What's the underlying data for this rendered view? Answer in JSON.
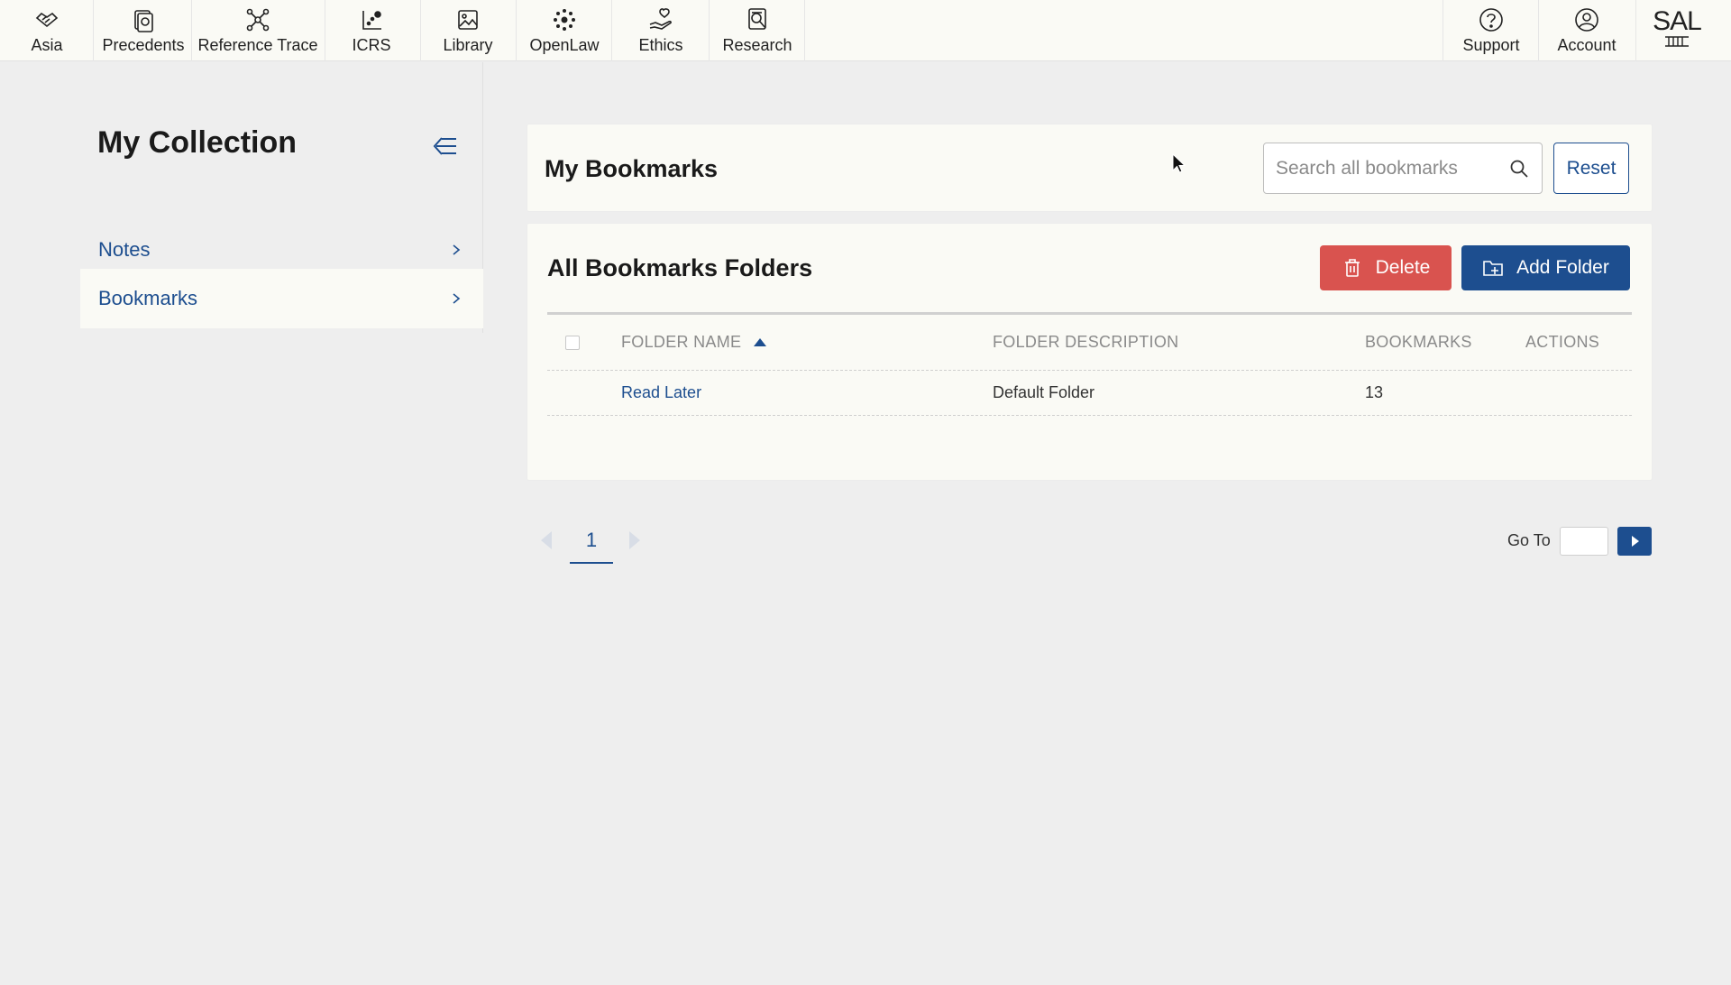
{
  "nav": {
    "items": [
      {
        "label": "Asia",
        "icon": "handshake-icon"
      },
      {
        "label": "Precedents",
        "icon": "documents-icon"
      },
      {
        "label": "Reference Trace",
        "icon": "network-icon"
      },
      {
        "label": "ICRS",
        "icon": "chart-icon"
      },
      {
        "label": "Library",
        "icon": "library-icon"
      },
      {
        "label": "OpenLaw",
        "icon": "openlaw-icon"
      },
      {
        "label": "Ethics",
        "icon": "ethics-icon"
      },
      {
        "label": "Research",
        "icon": "research-icon"
      }
    ],
    "right_items": [
      {
        "label": "Support",
        "icon": "help-icon"
      },
      {
        "label": "Account",
        "icon": "user-icon"
      }
    ],
    "logo_text": "SAL"
  },
  "sidebar": {
    "title": "My Collection",
    "items": [
      {
        "label": "Notes"
      },
      {
        "label": "Bookmarks"
      }
    ]
  },
  "bookmarks_header": {
    "title": "My Bookmarks",
    "search_placeholder": "Search all bookmarks",
    "search_value": "",
    "reset_label": "Reset"
  },
  "folders": {
    "title": "All Bookmarks Folders",
    "delete_label": "Delete",
    "add_label": "Add Folder",
    "columns": [
      "FOLDER NAME",
      "FOLDER DESCRIPTION",
      "BOOKMARKS",
      "ACTIONS"
    ],
    "rows": [
      {
        "name": "Read Later",
        "description": "Default Folder",
        "bookmarks": "13",
        "actions": ""
      }
    ]
  },
  "pagination": {
    "current_page": "1",
    "goto_label": "Go To",
    "goto_value": ""
  },
  "colors": {
    "accent": "#1d4e8f",
    "danger": "#d9534f",
    "panel": "#fafaf5",
    "background": "#eeeeee"
  }
}
